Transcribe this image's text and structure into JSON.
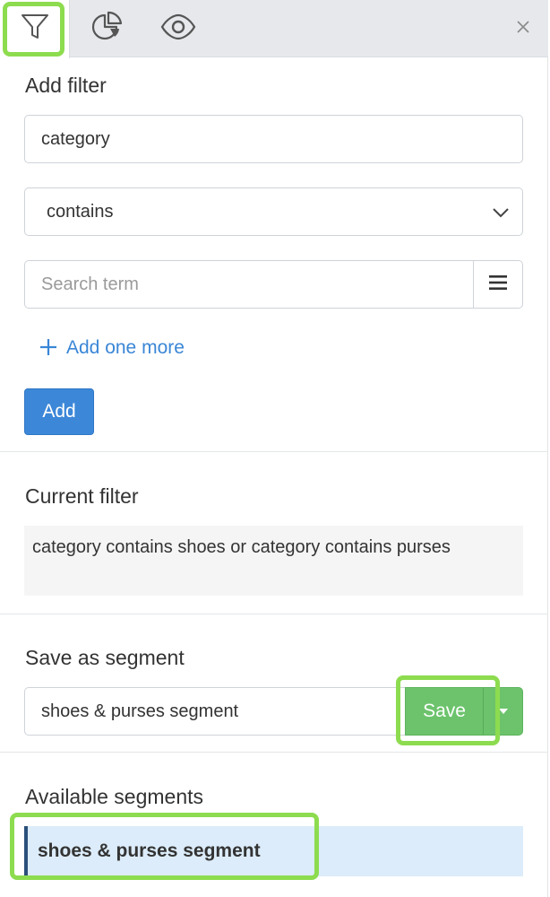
{
  "tabs": [
    {
      "name": "filter",
      "icon": "funnel-icon"
    },
    {
      "name": "chart",
      "icon": "pie-chart-icon"
    },
    {
      "name": "view",
      "icon": "eye-icon"
    }
  ],
  "close_icon": "close-icon",
  "add_filter": {
    "heading": "Add filter",
    "field_value": "category",
    "operator_value": "contains",
    "search_placeholder": "Search term",
    "add_one_more_label": "Add one more",
    "add_button_label": "Add"
  },
  "current_filter": {
    "heading": "Current filter",
    "text": "category contains shoes or category contains purses"
  },
  "save_segment": {
    "heading": "Save as segment",
    "input_value": "shoes & purses segment",
    "save_label": "Save"
  },
  "available_segments": {
    "heading": "Available segments",
    "items": [
      {
        "label": "shoes & purses segment"
      }
    ]
  },
  "colors": {
    "primary_blue": "#3c87d8",
    "save_green": "#6cc36c",
    "highlight_green": "#8ddc4f",
    "selected_segment_bg": "#dcecfa"
  }
}
